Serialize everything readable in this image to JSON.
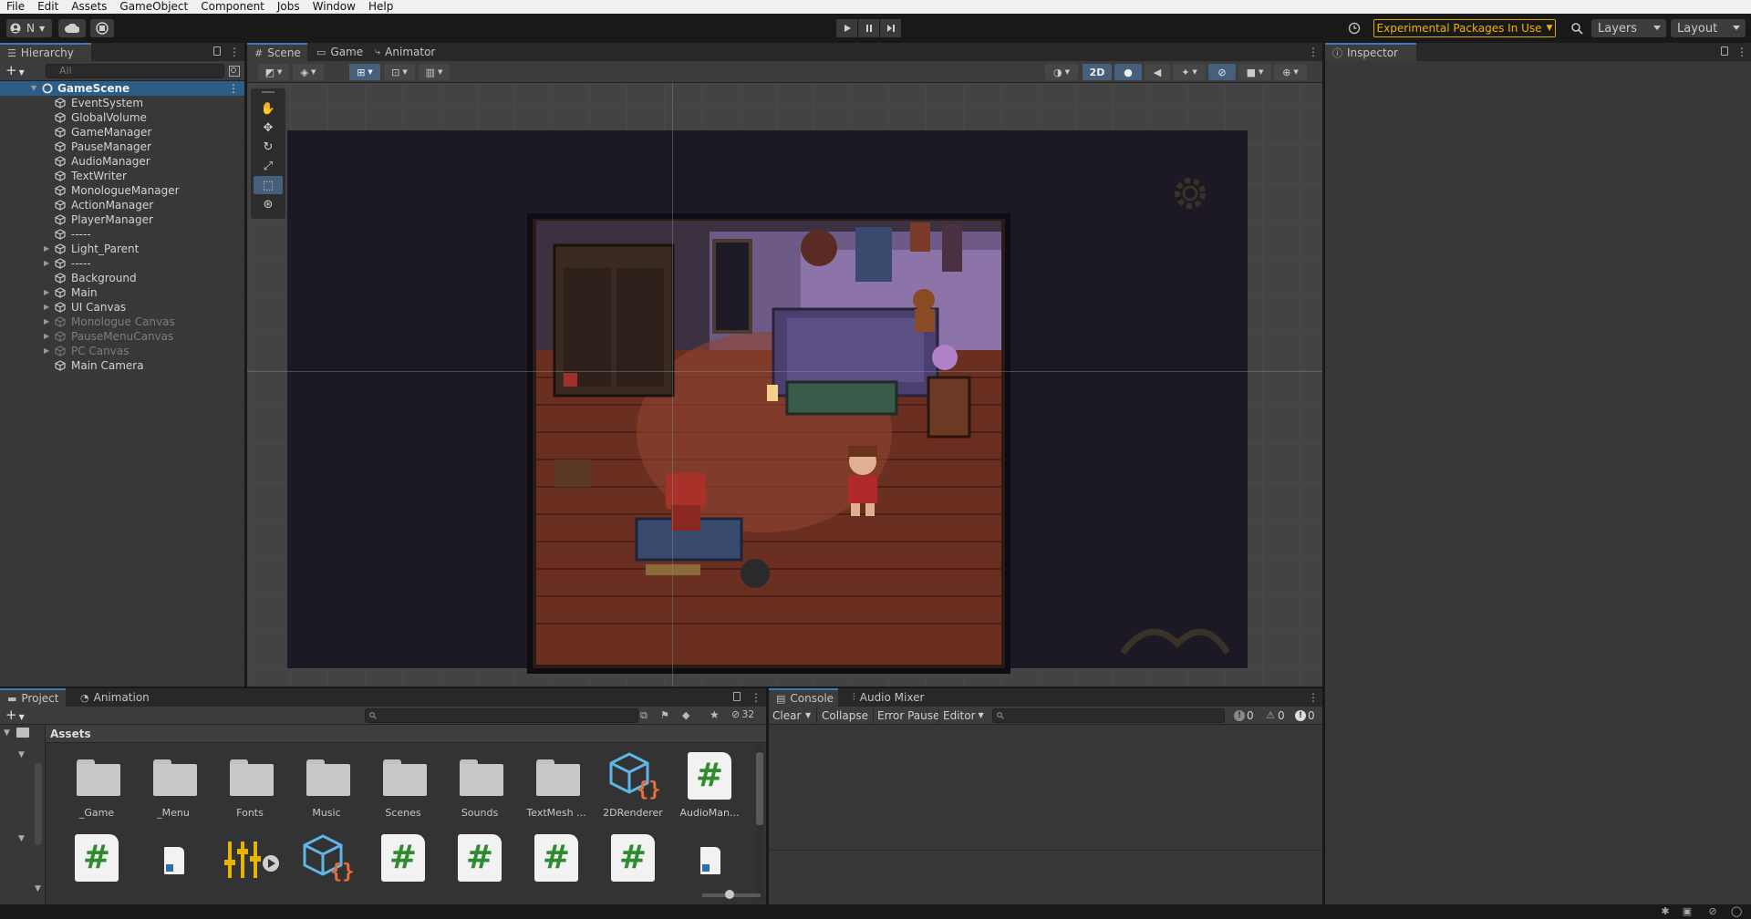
{
  "menu": [
    "File",
    "Edit",
    "Assets",
    "GameObject",
    "Component",
    "Jobs",
    "Window",
    "Help"
  ],
  "toolbar": {
    "account_label": "N",
    "experimental_label": "Experimental Packages In Use",
    "layers_label": "Layers",
    "layout_label": "Layout"
  },
  "hierarchy": {
    "tab_label": "Hierarchy",
    "search_placeholder": "All",
    "scene_name": "GameScene",
    "items": [
      {
        "label": "EventSystem",
        "expandable": false,
        "dim": false
      },
      {
        "label": "GlobalVolume",
        "expandable": false,
        "dim": false
      },
      {
        "label": "GameManager",
        "expandable": false,
        "dim": false
      },
      {
        "label": "PauseManager",
        "expandable": false,
        "dim": false
      },
      {
        "label": "AudioManager",
        "expandable": false,
        "dim": false
      },
      {
        "label": "TextWriter",
        "expandable": false,
        "dim": false
      },
      {
        "label": "MonologueManager",
        "expandable": false,
        "dim": false
      },
      {
        "label": "ActionManager",
        "expandable": false,
        "dim": false
      },
      {
        "label": "PlayerManager",
        "expandable": false,
        "dim": false
      },
      {
        "label": "-----",
        "expandable": false,
        "dim": false
      },
      {
        "label": "Light_Parent",
        "expandable": true,
        "dim": false
      },
      {
        "label": "-----",
        "expandable": true,
        "dim": false
      },
      {
        "label": "Background",
        "expandable": false,
        "dim": false
      },
      {
        "label": "Main",
        "expandable": true,
        "dim": false
      },
      {
        "label": "UI Canvas",
        "expandable": true,
        "dim": false
      },
      {
        "label": "Monologue Canvas",
        "expandable": true,
        "dim": true
      },
      {
        "label": "PauseMenuCanvas",
        "expandable": true,
        "dim": true
      },
      {
        "label": "PC Canvas",
        "expandable": true,
        "dim": true
      },
      {
        "label": "Main Camera",
        "expandable": false,
        "dim": false
      }
    ]
  },
  "scene": {
    "tabs": [
      "Scene",
      "Game",
      "Animator"
    ],
    "mode_2d_label": "2D"
  },
  "inspector": {
    "tab_label": "Inspector"
  },
  "project": {
    "tabs": [
      "Project",
      "Animation"
    ],
    "hidden_count": "32",
    "folder_label": "Assets",
    "assets_row1": [
      {
        "name": "_Game",
        "kind": "folder"
      },
      {
        "name": "_Menu",
        "kind": "folder"
      },
      {
        "name": "Fonts",
        "kind": "folder"
      },
      {
        "name": "Music",
        "kind": "folder"
      },
      {
        "name": "Scenes",
        "kind": "folder"
      },
      {
        "name": "Sounds",
        "kind": "folder"
      },
      {
        "name": "TextMesh ...",
        "kind": "folder"
      },
      {
        "name": "2DRenderer",
        "kind": "renderer"
      },
      {
        "name": "AudioMan...",
        "kind": "script"
      }
    ],
    "assets_row2": [
      {
        "kind": "script"
      },
      {
        "kind": "document"
      },
      {
        "kind": "mixer"
      },
      {
        "kind": "renderer"
      },
      {
        "kind": "script"
      },
      {
        "kind": "script"
      },
      {
        "kind": "script"
      },
      {
        "kind": "script"
      },
      {
        "kind": "document"
      }
    ]
  },
  "console": {
    "tabs": [
      "Console",
      "Audio Mixer"
    ],
    "clear_label": "Clear",
    "collapse_label": "Collapse",
    "error_pause_label": "Error Pause",
    "editor_label": "Editor",
    "log_count": "0",
    "warning_count": "0",
    "error_count": "0"
  },
  "colors": {
    "accent": "#3a79bb",
    "warning": "#f0b400",
    "script_hash": "#2e8b2e"
  }
}
